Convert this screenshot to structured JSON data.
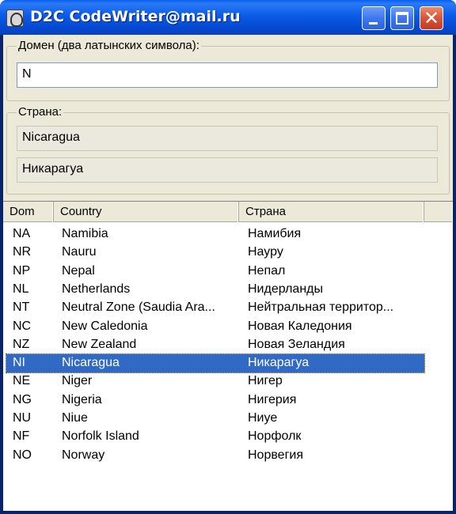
{
  "window": {
    "title": "D2C CodeWriter@mail.ru",
    "close_glyph": "✕"
  },
  "domain_group": {
    "legend": "Домен (два латынских символа):",
    "input_value": "N"
  },
  "country_group": {
    "legend": "Страна:",
    "name_en": "Nicaragua",
    "name_ru": "Никарагуа"
  },
  "table": {
    "columns": [
      "Dom",
      "Country",
      "Страна"
    ],
    "rows": [
      {
        "dom": "NA",
        "country": "Namibia",
        "strana": "Намибия",
        "selected": false
      },
      {
        "dom": "NR",
        "country": "Nauru",
        "strana": "Науру",
        "selected": false
      },
      {
        "dom": "NP",
        "country": "Nepal",
        "strana": "Непал",
        "selected": false
      },
      {
        "dom": "NL",
        "country": "Netherlands",
        "strana": "Нидерланды",
        "selected": false
      },
      {
        "dom": "NT",
        "country": "Neutral Zone (Saudia Ara...",
        "strana": "Нейтральная территор...",
        "selected": false
      },
      {
        "dom": "NC",
        "country": "New Caledonia",
        "strana": "Новая Каледония",
        "selected": false
      },
      {
        "dom": "NZ",
        "country": "New Zealand",
        "strana": "Новая Зеландия",
        "selected": false
      },
      {
        "dom": "NI",
        "country": "Nicaragua",
        "strana": "Никарагуа",
        "selected": true
      },
      {
        "dom": "NE",
        "country": "Niger",
        "strana": "Нигер",
        "selected": false
      },
      {
        "dom": "NG",
        "country": "Nigeria",
        "strana": "Нигерия",
        "selected": false
      },
      {
        "dom": "NU",
        "country": "Niue",
        "strana": "Ниуе",
        "selected": false
      },
      {
        "dom": "NF",
        "country": "Norfolk Island",
        "strana": "Норфолк",
        "selected": false
      },
      {
        "dom": "NO",
        "country": "Norway",
        "strana": "Норвегия",
        "selected": false
      }
    ]
  }
}
